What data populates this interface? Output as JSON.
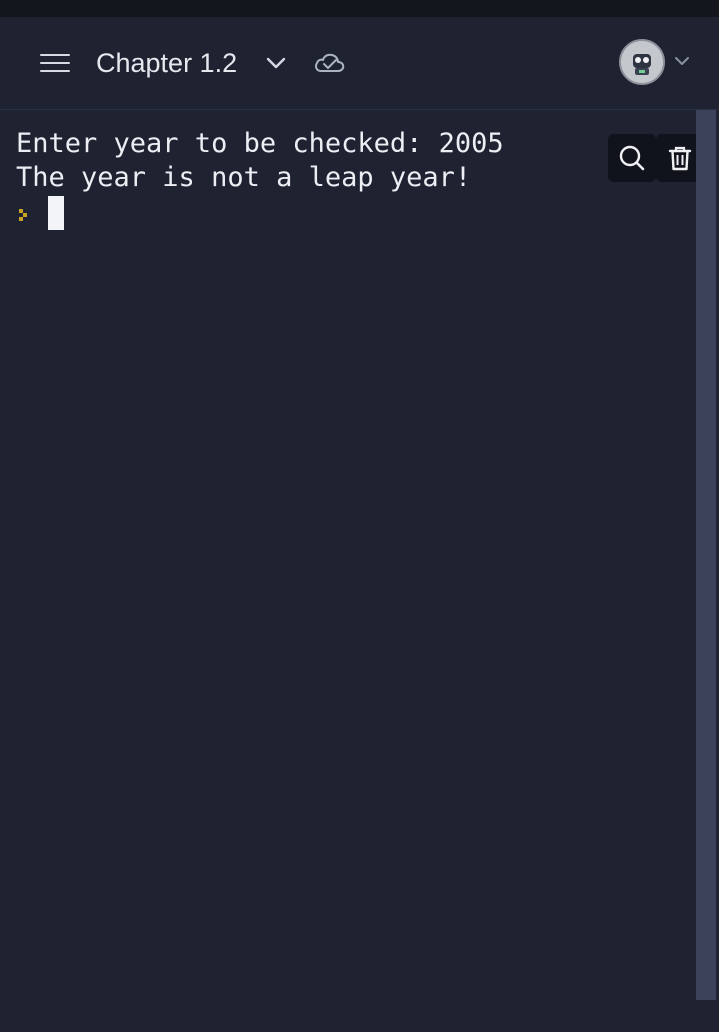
{
  "header": {
    "chapter_title": "Chapter 1.2"
  },
  "console": {
    "lines": [
      "Enter year to be checked: 2005",
      "The year is not a leap year!"
    ]
  },
  "icons": {
    "menu": "hamburger-menu-icon",
    "chevron": "chevron-down-icon",
    "sync": "cloud-check-icon",
    "avatar": "robot-avatar",
    "search": "search-icon",
    "delete": "trash-icon",
    "prompt": "prompt-chevron-icon"
  },
  "colors": {
    "background": "#1e2231",
    "text": "#eceef3",
    "prompt": "#c9a227",
    "scrollbar": "#3b4259"
  }
}
